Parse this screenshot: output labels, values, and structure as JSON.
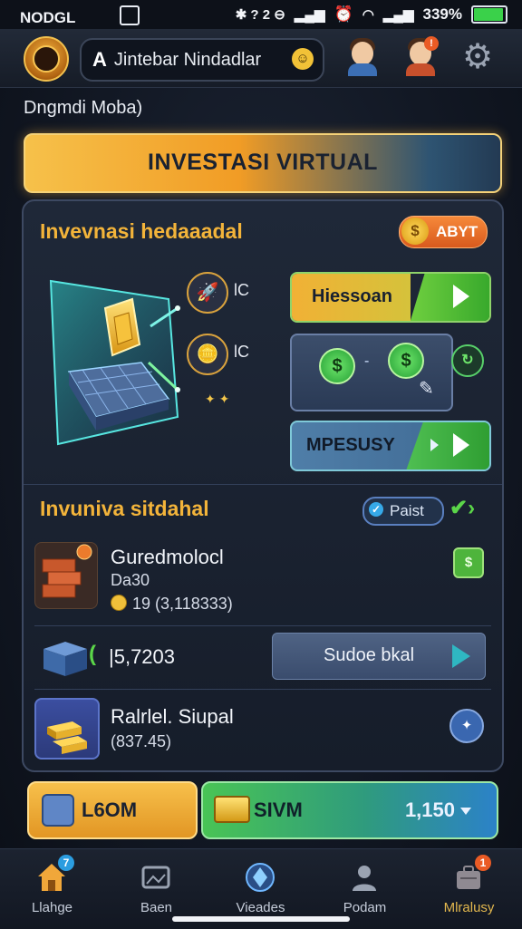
{
  "status_bar": {
    "carrier": "NODGL",
    "icons_mid": "✱ ? 2 ⊖",
    "battery_percent": "339%",
    "battery_level": 0.9
  },
  "header": {
    "search_prefix": "A",
    "search_text": "Jintebar Nindadlar",
    "notification_count": "!"
  },
  "subtitle": "Dngmdi Moba)",
  "banner": {
    "label": "INVESTASI VIRTUAL"
  },
  "section1": {
    "title": "Invevnasi hedaaadal",
    "badge": {
      "coin": "$",
      "label": "ABYT"
    },
    "side_items": [
      {
        "value": "lC"
      },
      {
        "value": "lC"
      }
    ],
    "btn_primary": {
      "label": "Hiessoan"
    },
    "btn_secondary": {
      "label": "MPESUSY"
    }
  },
  "section2": {
    "title": "Invuniva sitdahal",
    "filter": {
      "label": "Paist"
    },
    "items": [
      {
        "title": "Guredmolocl",
        "subtitle": "Da30",
        "amount": "19 (3,118333)"
      },
      {
        "amount": "|5,7203",
        "action_label": "Sudoe bkal"
      },
      {
        "title": "Ralrlel. Siupal",
        "subtitle": "(837.45)"
      }
    ]
  },
  "footer": {
    "left_label": "L6OM",
    "right_label": "SIVM",
    "right_value": "1,150"
  },
  "tabs": [
    {
      "label": "Llahge",
      "badge": "7"
    },
    {
      "label": "Baen"
    },
    {
      "label": "Vieades"
    },
    {
      "label": "Podam"
    },
    {
      "label": "Mlralusy",
      "badge": "1"
    }
  ],
  "colors": {
    "accent_gold": "#f3b43a",
    "accent_green": "#4fbf52",
    "panel_bg": "#1f2838"
  }
}
